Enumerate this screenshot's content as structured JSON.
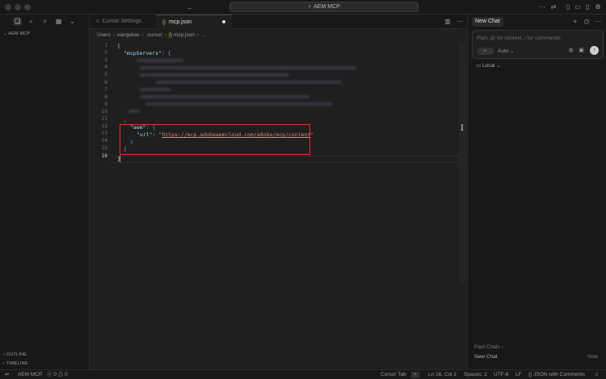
{
  "titlebar": {
    "search_text": "AEM MCP",
    "icons": [
      "arrow-left-icon",
      "search-icon",
      "sync-icon",
      "layout-icons",
      "gear-icon"
    ]
  },
  "sidebar": {
    "explorer_title": "AEM MCP",
    "outline_label": "OUTLINE",
    "timeline_label": "TIMELINE"
  },
  "tabs": [
    {
      "label": "Cursor Settings",
      "active": false
    },
    {
      "label": "mcp.json",
      "active": true,
      "dirty": true
    }
  ],
  "breadcrumb": [
    "Users",
    "vangeluw",
    ".cursor",
    "mcp.json",
    "..."
  ],
  "editor": {
    "line_numbers": [
      "1",
      "2",
      "3",
      "4",
      "5",
      "6",
      "7",
      "8",
      "9",
      "10",
      "11",
      "12",
      "13",
      "14",
      "15",
      "16"
    ],
    "current_line": "16",
    "lines": {
      "l1": "{",
      "l2_key": "\"mcpServers\"",
      "l2_tail": ": {",
      "l12_key": "\"aem\"",
      "l12_tail": ": {",
      "l13_key": "\"url\"",
      "l13_colon": ": ",
      "l13_q1": "\"",
      "l13_url": "https://mcp.adobeaemcloud.com/adobe/mcp/content",
      "l13_q2": "\"",
      "l14": "}",
      "l15": "}",
      "l16": "}"
    }
  },
  "chat": {
    "tab_label": "New Chat",
    "input_placeholder": "Plan, @ for context, / for commands",
    "agent_label": "∞",
    "model_label": "Auto",
    "local_label": "Local",
    "past_chats_label": "Past Chats",
    "past_item_title": "New Chat",
    "past_item_time": "Now"
  },
  "statusbar": {
    "remote": "AEM MCP",
    "problems": "0",
    "warnings": "0",
    "cursor_tab": "Cursor Tab",
    "position": "Ln 16, Col 2",
    "spaces": "Spaces: 2",
    "encoding": "UTF-8",
    "eol": "LF",
    "language": "JSON with Comments"
  },
  "colors": {
    "highlight_border": "#e0362c",
    "brace_level1": "#d7c35a",
    "brace_level2": "#d670d6",
    "brace_level3": "#3d9cf0",
    "json_key": "#9cdcfe",
    "json_string": "#ce9178"
  }
}
